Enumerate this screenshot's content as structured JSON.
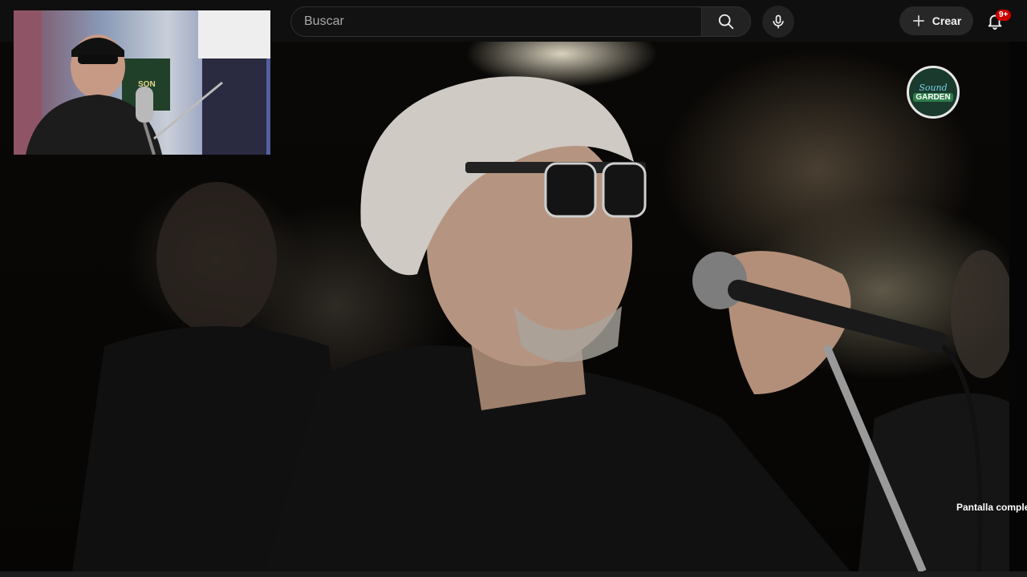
{
  "header": {
    "search_placeholder": "Buscar",
    "create_label": "Crear",
    "notification_count": "9+"
  },
  "video": {
    "logo_line1": "Sound",
    "logo_line2": "GARDEN",
    "fullscreen_tooltip": "Pantalla comple"
  },
  "pip": {
    "poster_text": "SON"
  },
  "icons": {
    "search": "search-icon",
    "mic": "mic-icon",
    "create": "plus-icon",
    "notifications": "bell-icon"
  },
  "colors": {
    "background": "#0f0f0f",
    "badge": "#cc0000"
  }
}
